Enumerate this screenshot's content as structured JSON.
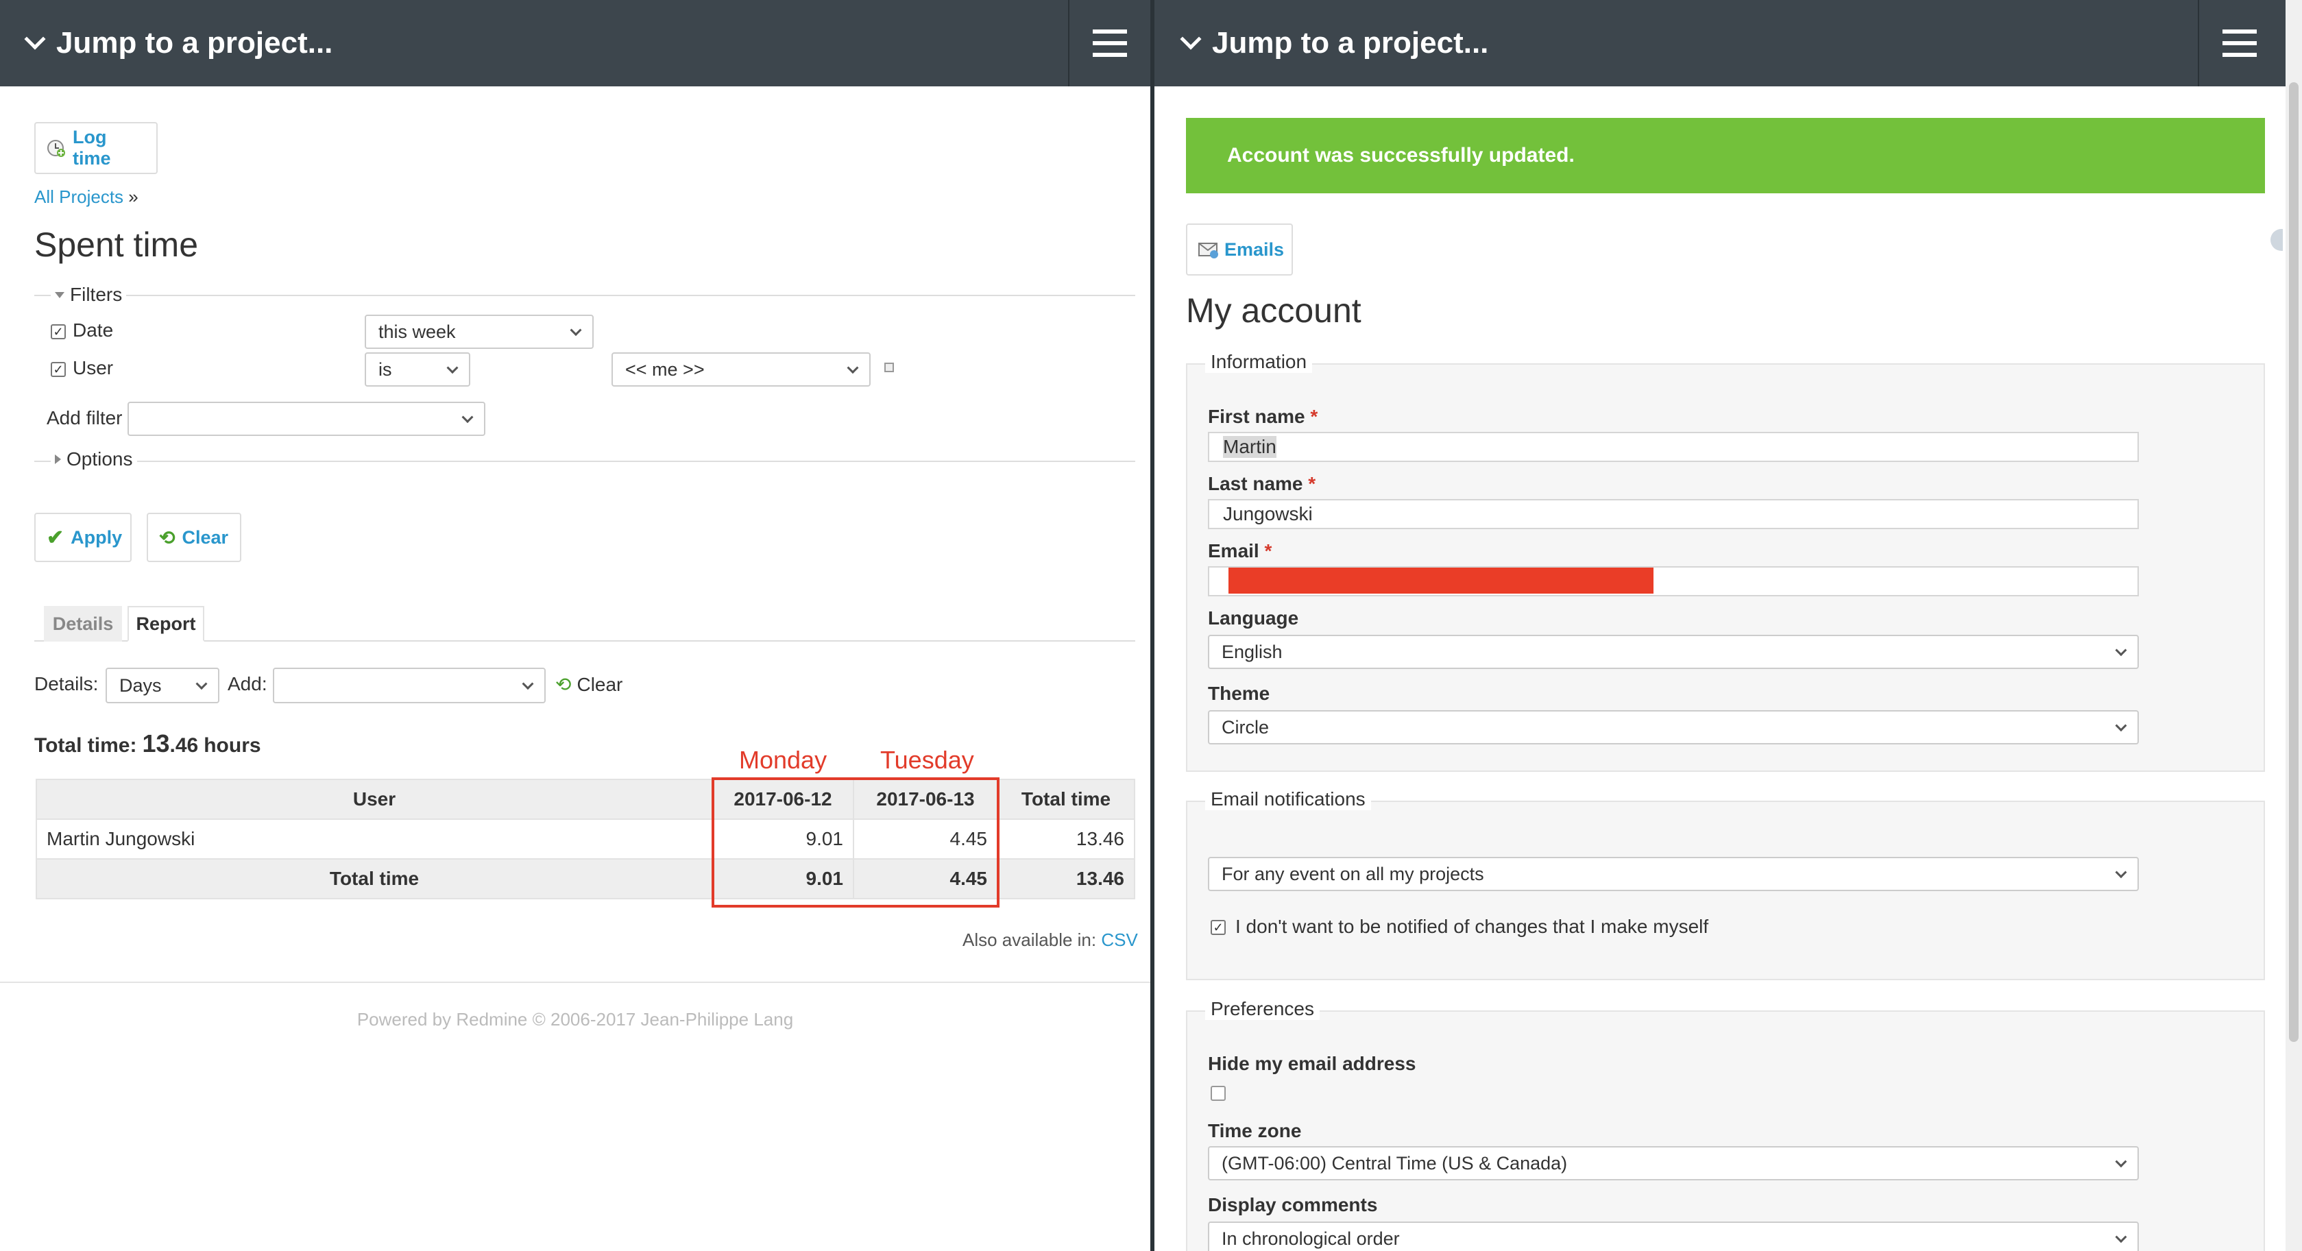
{
  "left": {
    "topbar": {
      "jump_label": "Jump to a project..."
    },
    "log_time_button": "Log time",
    "breadcrumb": {
      "link": "All Projects",
      "separator": "»"
    },
    "page_title": "Spent time",
    "filters": {
      "legend": "Filters",
      "date": {
        "label": "Date",
        "value": "this week"
      },
      "user": {
        "label": "User",
        "operator": "is",
        "value": "<< me >>"
      },
      "add_filter_label": "Add filter",
      "add_filter_value": ""
    },
    "options_label": "Options",
    "apply_button": "Apply",
    "clear_button": "Clear",
    "tabs": [
      "Details",
      "Report"
    ],
    "details_row": {
      "details_label": "Details:",
      "details_value": "Days",
      "add_label": "Add:",
      "add_value": "",
      "clear_link": "Clear"
    },
    "total_time": {
      "label": "Total time:",
      "int": "13",
      "dec": ".46",
      "unit": "hours"
    },
    "annotations": {
      "monday": "Monday",
      "tuesday": "Tuesday"
    },
    "report": {
      "headers": [
        "User",
        "2017-06-12",
        "2017-06-13",
        "Total time"
      ],
      "rows": [
        {
          "user": "Martin Jungowski",
          "d1": "9.01",
          "d2": "4.45",
          "total": "13.46"
        }
      ],
      "total_row": {
        "label": "Total time",
        "d1": "9.01",
        "d2": "4.45",
        "total": "13.46"
      }
    },
    "also_available": {
      "label": "Also available in:",
      "csv": "CSV"
    },
    "footer": "Powered by Redmine © 2006-2017 Jean-Philippe Lang"
  },
  "right": {
    "topbar": {
      "jump_label": "Jump to a project..."
    },
    "flash": "Account was successfully updated.",
    "emails_button": "Emails",
    "page_title": "My account",
    "information": {
      "legend": "Information",
      "first_name_label": "First name",
      "first_name": "Martin",
      "last_name_label": "Last name",
      "last_name": "Jungowski",
      "email_label": "Email",
      "required_mark": "*",
      "language_label": "Language",
      "language": "English",
      "theme_label": "Theme",
      "theme": "Circle"
    },
    "email_notifications": {
      "legend": "Email notifications",
      "value": "For any event on all my projects",
      "no_self_notified": "I don't want to be notified of changes that I make myself"
    },
    "preferences": {
      "legend": "Preferences",
      "hide_mail_label": "Hide my email address",
      "time_zone_label": "Time zone",
      "time_zone": "(GMT-06:00) Central Time (US & Canada)",
      "comments_label": "Display comments",
      "comments": "In chronological order"
    }
  },
  "colors": {
    "topbar": "#3d464d",
    "link": "#2996cc",
    "flash": "#73c13b",
    "annotation": "#e23b2a",
    "redaction": "#ea3d27"
  }
}
